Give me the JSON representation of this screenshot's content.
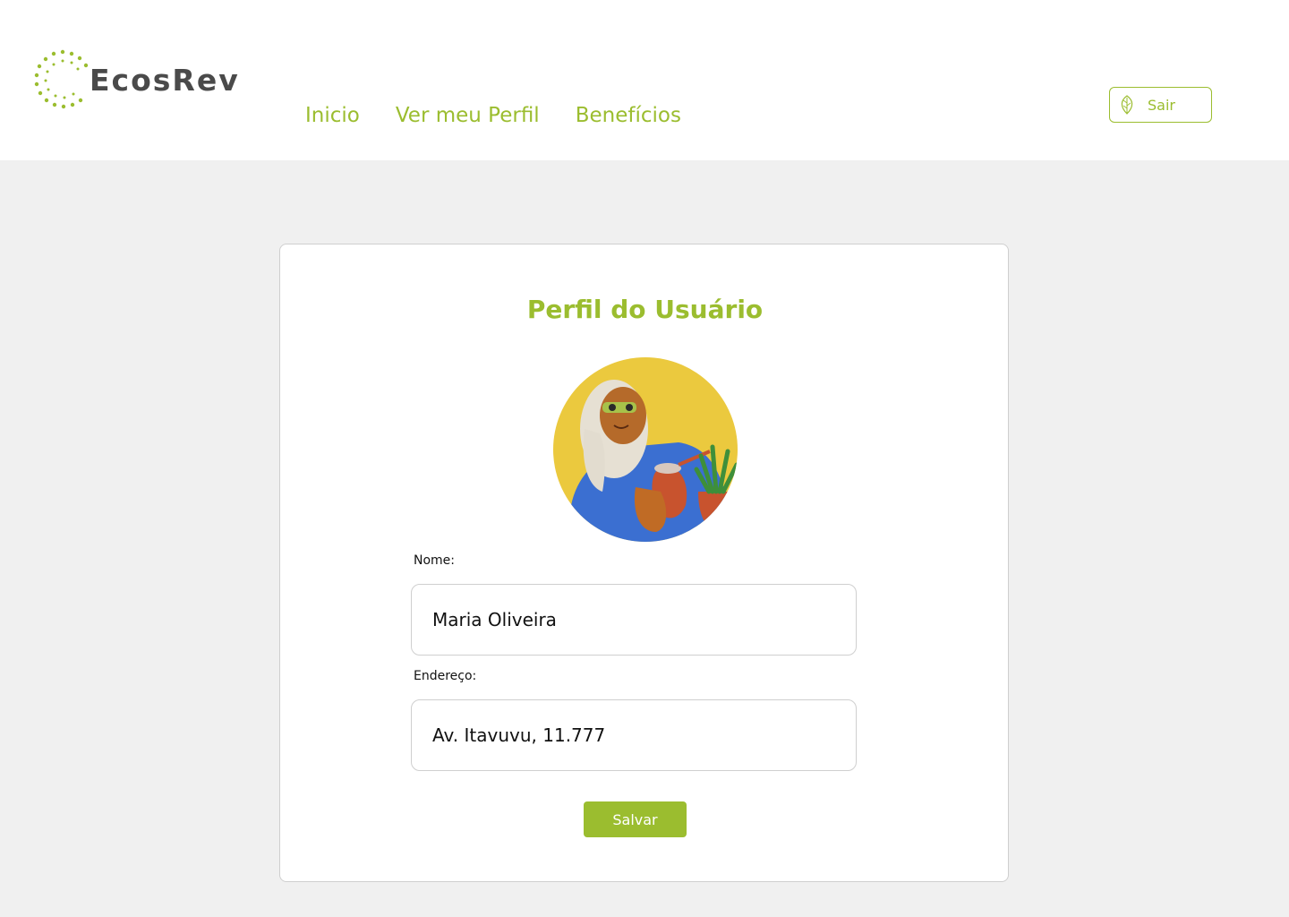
{
  "brand": {
    "name": "EcosRev",
    "accent_color": "#9bbd2f",
    "logo_icon": "dotted-circle-logo-icon"
  },
  "nav": {
    "items": [
      {
        "label": "Inicio"
      },
      {
        "label": "Ver meu Perfil"
      },
      {
        "label": "Benefícios"
      }
    ]
  },
  "header": {
    "logout_label": "Sair",
    "logout_icon": "leaf-icon"
  },
  "profile": {
    "title": "Perfil do Usuário",
    "avatar_icon": "user-avatar-illustration",
    "name_label": "Nome:",
    "name_value": "Maria Oliveira",
    "address_label": "Endereço:",
    "address_value": "Av. Itavuvu, 11.777",
    "save_label": "Salvar"
  }
}
